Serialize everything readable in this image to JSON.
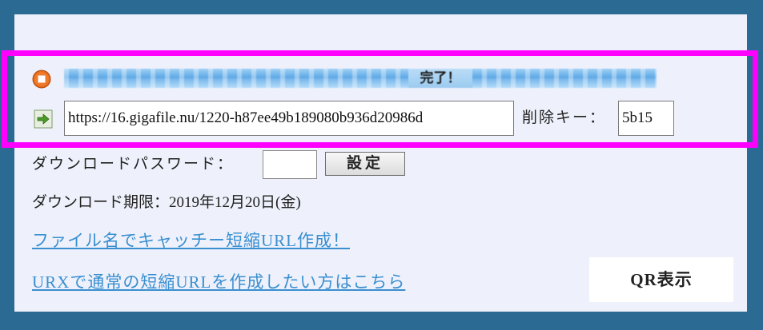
{
  "upload": {
    "status_text": "完了！",
    "progress_fraction": 1.0,
    "url_value": "https://16.gigafile.nu/1220-h87ee49b189080b936d20986d",
    "delete_key_label": "削除キー：",
    "delete_key_value": "5b15"
  },
  "password": {
    "label": "ダウンロードパスワード：",
    "value": "",
    "set_button_label": "設定"
  },
  "deadline": {
    "text": "ダウンロード期限：2019年12月20日(金)"
  },
  "links": {
    "catchy_short_url": "ファイル名でキャッチー短縮URL作成！",
    "urx_short_url": "URXで通常の短縮URLを作成したい方はこちら"
  },
  "qr_button_label": "QR表示",
  "colors": {
    "frame": "#2b6b93",
    "panel": "#eef1fb",
    "highlight": "#ff00ff",
    "link": "#3a8fd0",
    "progress": "#7ab8ec"
  },
  "icons": {
    "stop": "stop-icon",
    "arrow": "arrow-right-icon"
  }
}
